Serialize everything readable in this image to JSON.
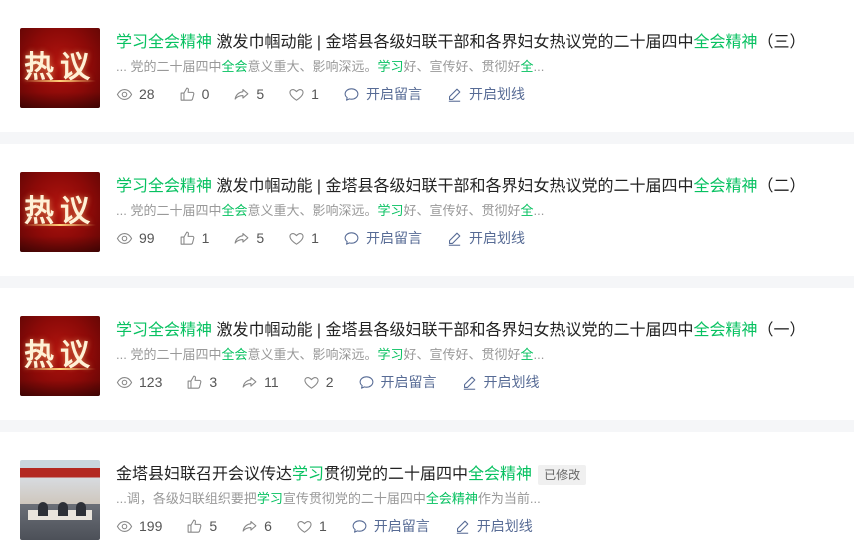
{
  "articles": [
    {
      "thumb_text": "热议",
      "title": {
        "p1": "学习全会精神",
        "p2": " 激发巾帼动能 | 金塔县各级妇联干部和各界妇女热议党的二十届四中",
        "p3": "全会精神",
        "p4": "（三）"
      },
      "summary": {
        "s1": "... 党的二十届四中",
        "s2": "全会",
        "s3": "意义重大、影响深远。",
        "s4": "学习",
        "s5": "好、宣传好、贯彻好",
        "s6": "全",
        "s7": "..."
      },
      "views": "28",
      "likes": "0",
      "shares": "5",
      "favorites": "1",
      "comment_label": "开启留言",
      "underline_label": "开启划线"
    },
    {
      "thumb_text": "热议",
      "title": {
        "p1": "学习全会精神",
        "p2": " 激发巾帼动能 | 金塔县各级妇联干部和各界妇女热议党的二十届四中",
        "p3": "全会精神",
        "p4": "（二）"
      },
      "summary": {
        "s1": "... 党的二十届四中",
        "s2": "全会",
        "s3": "意义重大、影响深远。",
        "s4": "学习",
        "s5": "好、宣传好、贯彻好",
        "s6": "全",
        "s7": "..."
      },
      "views": "99",
      "likes": "1",
      "shares": "5",
      "favorites": "1",
      "comment_label": "开启留言",
      "underline_label": "开启划线"
    },
    {
      "thumb_text": "热议",
      "title": {
        "p1": "学习全会精神",
        "p2": " 激发巾帼动能 | 金塔县各级妇联干部和各界妇女热议党的二十届四中",
        "p3": "全会精神",
        "p4": "（一）"
      },
      "summary": {
        "s1": "... 党的二十届四中",
        "s2": "全会",
        "s3": "意义重大、影响深远。",
        "s4": "学习",
        "s5": "好、宣传好、贯彻好",
        "s6": "全",
        "s7": "..."
      },
      "views": "123",
      "likes": "3",
      "shares": "11",
      "favorites": "2",
      "comment_label": "开启留言",
      "underline_label": "开启划线"
    },
    {
      "title": {
        "p1": "金塔县妇联召开会议传达",
        "p2": "学习",
        "p3": "贯彻党的二十届四中",
        "p4": "全会精神",
        "badge": "已修改"
      },
      "summary": {
        "s1": "...调，各级妇联组织要把",
        "s2": "学习",
        "s3": "宣传贯彻党的二十届四中",
        "s4": "全会精神",
        "s5": "作为当前..."
      },
      "views": "199",
      "likes": "5",
      "shares": "6",
      "favorites": "1",
      "comment_label": "开启留言",
      "underline_label": "开启划线"
    }
  ],
  "icons": {
    "views": "eye-icon",
    "likes": "thumbs-up-icon",
    "shares": "share-icon",
    "favorites": "heart-icon",
    "comment": "comment-bubble-icon",
    "underline": "pen-icon"
  },
  "colors": {
    "highlight": "#07c160",
    "action": "#576b95",
    "muted": "#999999",
    "background": "#f5f6f8"
  }
}
